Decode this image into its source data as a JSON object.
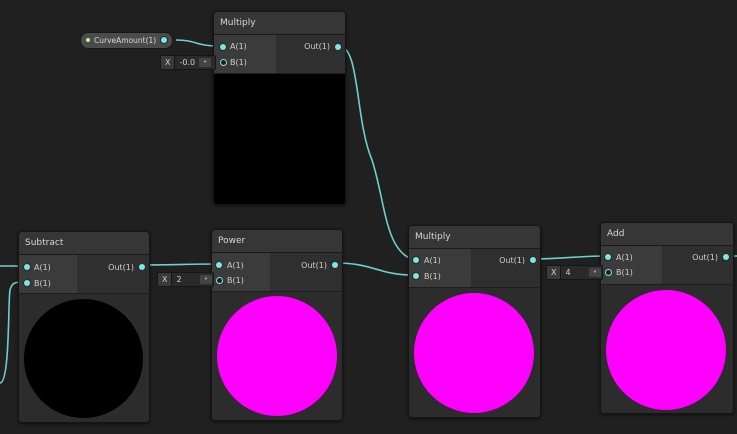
{
  "property_node": {
    "label": "CurveAmount(1)"
  },
  "nodes": {
    "multiply_top": {
      "title": "Multiply",
      "inputs": [
        "A(1)",
        "B(1)"
      ],
      "output": "Out(1)",
      "inline_b": {
        "axis": "X",
        "value": "-0.0"
      }
    },
    "subtract": {
      "title": "Subtract",
      "inputs": [
        "A(1)",
        "B(1)"
      ],
      "output": "Out(1)"
    },
    "power": {
      "title": "Power",
      "inputs": [
        "A(1)",
        "B(1)"
      ],
      "output": "Out(1)",
      "inline_b": {
        "axis": "X",
        "value": "2"
      }
    },
    "multiply_bottom": {
      "title": "Multiply",
      "inputs": [
        "A(1)",
        "B(1)"
      ],
      "output": "Out(1)"
    },
    "add": {
      "title": "Add",
      "inputs": [
        "A(1)",
        "B(1)"
      ],
      "output": "Out(1)",
      "inline_b": {
        "axis": "X",
        "value": "4"
      }
    }
  },
  "colors": {
    "background": "#202020",
    "wire": "#6fcfcc",
    "port": "#7de7e6",
    "preview_magenta": "#ff00ff",
    "preview_black": "#000000"
  }
}
